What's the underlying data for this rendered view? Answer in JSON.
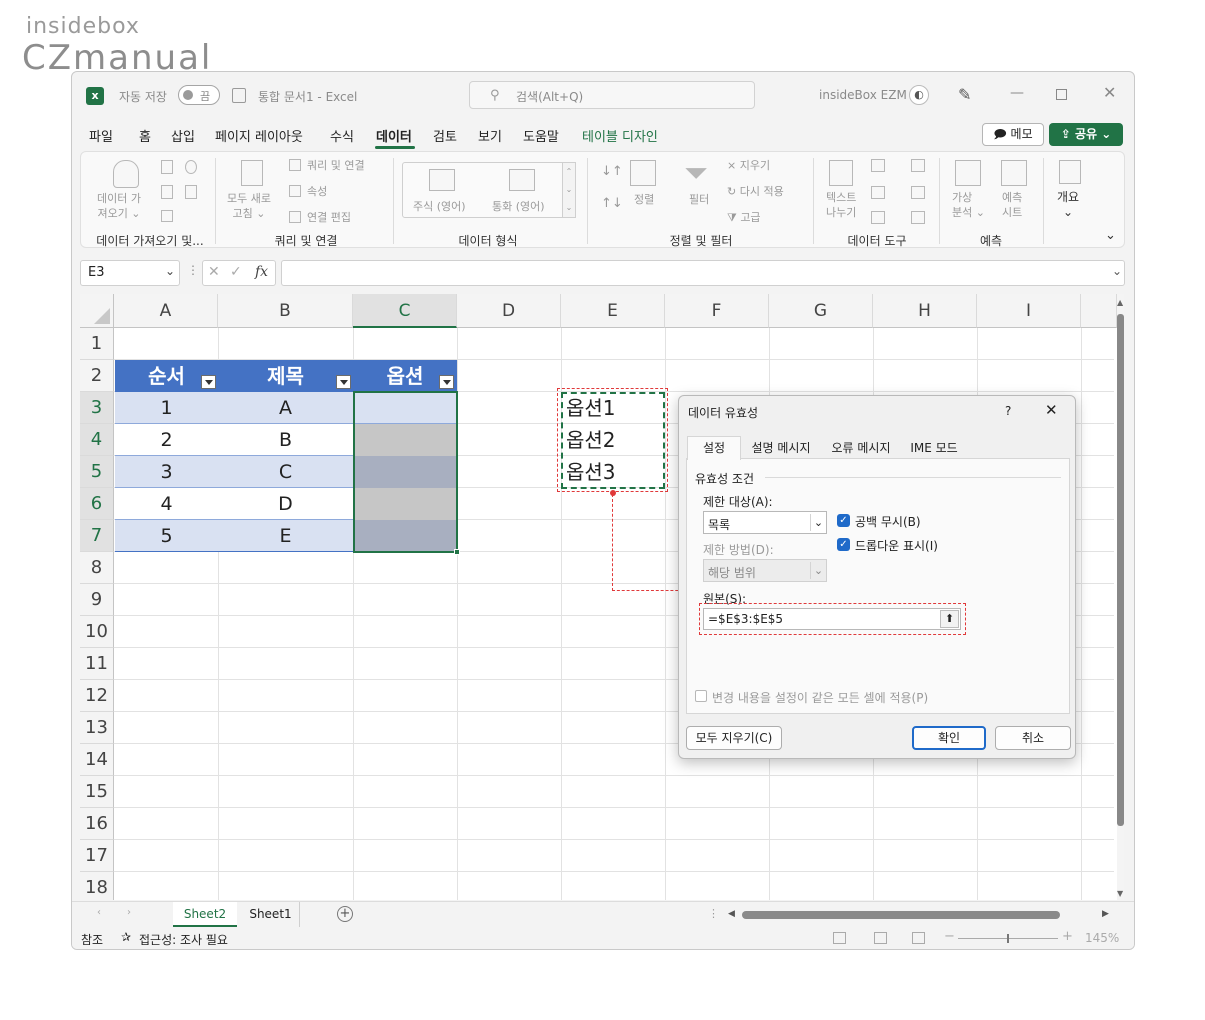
{
  "logo": {
    "top": "insidebox",
    "main": "CZmanual"
  },
  "titlebar": {
    "autosave_label": "자동 저장",
    "autosave_state": "끔",
    "doc_title": "통합 문서1  -  Excel",
    "search_placeholder": "검색(Alt+Q)",
    "user_name": "insideBox EZM"
  },
  "menu": {
    "items": [
      "파일",
      "홈",
      "삽입",
      "페이지 레이아웃",
      "수식",
      "데이터",
      "검토",
      "보기",
      "도움말",
      "테이블 디자인"
    ],
    "active": "데이터",
    "comments": "메모",
    "share": "공유"
  },
  "ribbon": {
    "get_data": "데이터 가\n져오기 ⌄",
    "refresh_all": "모두 새로\n고침 ⌄",
    "queries_connections": "쿼리 및 연결",
    "properties": "속성",
    "edit_links": "연결 편집",
    "stocks": "주식 (영어)",
    "currencies": "통화 (영어)",
    "sort": "정렬",
    "filter": "필터",
    "clear": "지우기",
    "reapply": "다시 적용",
    "advanced": "고급",
    "text_to_columns": "텍스트\n나누기",
    "what_if": "가상\n분석 ⌄",
    "forecast_sheet": "예측\n시트",
    "outline": "개요",
    "groups": [
      "데이터 가져오기 및...",
      "쿼리 및 연결",
      "데이터 형식",
      "정렬 및 필터",
      "데이터 도구",
      "예측"
    ]
  },
  "formula_bar": {
    "name_box": "E3",
    "fx": "fx",
    "formula": ""
  },
  "columns": [
    "A",
    "B",
    "C",
    "D",
    "E",
    "F",
    "G",
    "H",
    "I"
  ],
  "rows": [
    "1",
    "2",
    "3",
    "4",
    "5",
    "6",
    "7",
    "8",
    "9",
    "10",
    "11",
    "12",
    "13",
    "14",
    "15",
    "16",
    "17",
    "18"
  ],
  "table": {
    "headers": [
      "순서",
      "제목",
      "옵션"
    ],
    "rows": [
      [
        "1",
        "A",
        ""
      ],
      [
        "2",
        "B",
        ""
      ],
      [
        "3",
        "C",
        ""
      ],
      [
        "4",
        "D",
        ""
      ],
      [
        "5",
        "E",
        ""
      ]
    ]
  },
  "options_list": [
    "옵션1",
    "옵션2",
    "옵션3"
  ],
  "dialog": {
    "title": "데이터 유효성",
    "help": "?",
    "tabs": [
      "설정",
      "설명 메시지",
      "오류 메시지",
      "IME 모드"
    ],
    "criteria_label": "유효성 조건",
    "allow_label": "제한 대상(A):",
    "allow_value": "목록",
    "ignore_blank": "공백 무시(B)",
    "in_cell_dropdown": "드롭다운 표시(I)",
    "data_label": "제한 방법(D):",
    "data_value": "해당 범위",
    "source_label": "원본(S):",
    "source_value": "=$E$3:$E$5",
    "apply_all": "변경 내용을 설정이 같은 모든 셀에 적용(P)",
    "clear_all": "모두 지우기(C)",
    "ok": "확인",
    "cancel": "취소"
  },
  "sheets": {
    "tabs": [
      "Sheet2",
      "Sheet1"
    ],
    "active": "Sheet2"
  },
  "status": {
    "mode": "참조",
    "accessibility": "접근성: 조사 필요",
    "zoom": "145%"
  },
  "colors": {
    "excel_green": "#217346",
    "table_header": "#4472c4",
    "selection_red": "#e0393a"
  }
}
